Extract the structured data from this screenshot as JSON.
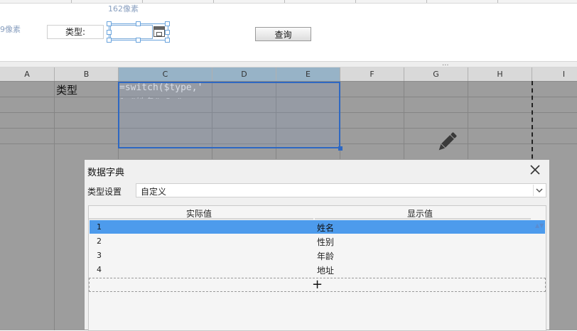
{
  "param_panel": {
    "dim_top": "162像素",
    "dim_left": "9像素",
    "type_label": "类型:",
    "query_button": "查询",
    "splitter_dots": "..."
  },
  "sheet": {
    "columns": [
      "A",
      "B",
      "C",
      "D",
      "E",
      "F",
      "G",
      "H",
      "I"
    ],
    "cell_b2": "类型",
    "cell_c2_formula": "=switch($type,'",
    "cell_c2_formula_line2": "1,\"姓名\",2,\""
  },
  "dialog": {
    "title": "数据字典",
    "type_setting_label": "类型设置",
    "type_setting_value": "自定义",
    "table": {
      "headers": [
        "实际值",
        "显示值"
      ],
      "rows": [
        {
          "value": "1",
          "display": "姓名"
        },
        {
          "value": "2",
          "display": "性别"
        },
        {
          "value": "3",
          "display": "年龄"
        },
        {
          "value": "4",
          "display": "地址"
        }
      ],
      "selected_row": 0,
      "add_label": "+"
    }
  },
  "icons": {
    "close": "close-icon",
    "dropdown": "chevron-down-icon",
    "calendar": "calendar-icon",
    "pencil": "pencil-icon",
    "sort": "sort-icon"
  },
  "colors": {
    "selection_border": "#2e68c2",
    "selected_row": "#4d9bec",
    "header_selected": "#97b3c7"
  }
}
